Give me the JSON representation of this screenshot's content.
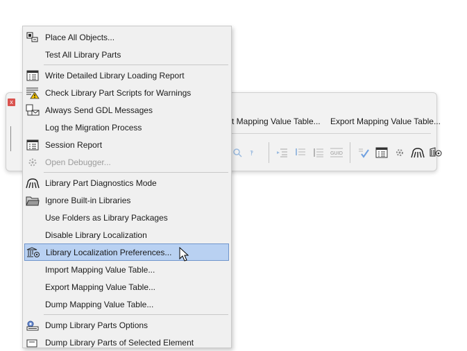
{
  "palette": {
    "close_label": "x",
    "toolbar_row1": [
      "t Mapping Value Table...",
      "Export Mapping Value Table..."
    ],
    "toolbar_icons_row2": [
      "search-icon",
      "script-check-icon",
      "indent-icon",
      "list-icon",
      "list-icon",
      "guid-icon",
      "check-icon",
      "report-icon",
      "debugger-icon",
      "diagnostics-icon",
      "localization-icon"
    ]
  },
  "menu": {
    "sections": [
      [
        {
          "label": "Place All Objects...",
          "icon": "place-objects-icon"
        },
        {
          "label": "Test All Library Parts",
          "icon": ""
        }
      ],
      [
        {
          "label": "Write Detailed Library Loading Report",
          "icon": "report-icon"
        },
        {
          "label": "Check Library Part Scripts for Warnings",
          "icon": "script-warning-icon"
        },
        {
          "label": "Always Send GDL Messages",
          "icon": "gdl-messages-icon"
        },
        {
          "label": "Log the Migration Process",
          "icon": ""
        },
        {
          "label": "Session Report",
          "icon": "report-icon"
        },
        {
          "label": "Open Debugger...",
          "icon": "debugger-icon",
          "disabled": true
        }
      ],
      [
        {
          "label": "Library Part Diagnostics Mode",
          "icon": "diagnostics-icon"
        },
        {
          "label": "Ignore Built-in Libraries",
          "icon": "folder-icon"
        },
        {
          "label": "Use Folders as Library Packages",
          "icon": ""
        },
        {
          "label": "Disable Library Localization",
          "icon": ""
        },
        {
          "label": "Library Localization Preferences...",
          "icon": "localization-icon",
          "selected": true
        },
        {
          "label": "Import Mapping Value Table...",
          "icon": ""
        },
        {
          "label": "Export Mapping Value Table...",
          "icon": ""
        },
        {
          "label": "Dump Mapping Value Table...",
          "icon": ""
        }
      ],
      [
        {
          "label": "Dump Library Parts Options",
          "icon": "dump-options-icon"
        },
        {
          "label": "Dump Library Parts of Selected Element",
          "icon": "dump-selected-icon"
        }
      ]
    ]
  }
}
